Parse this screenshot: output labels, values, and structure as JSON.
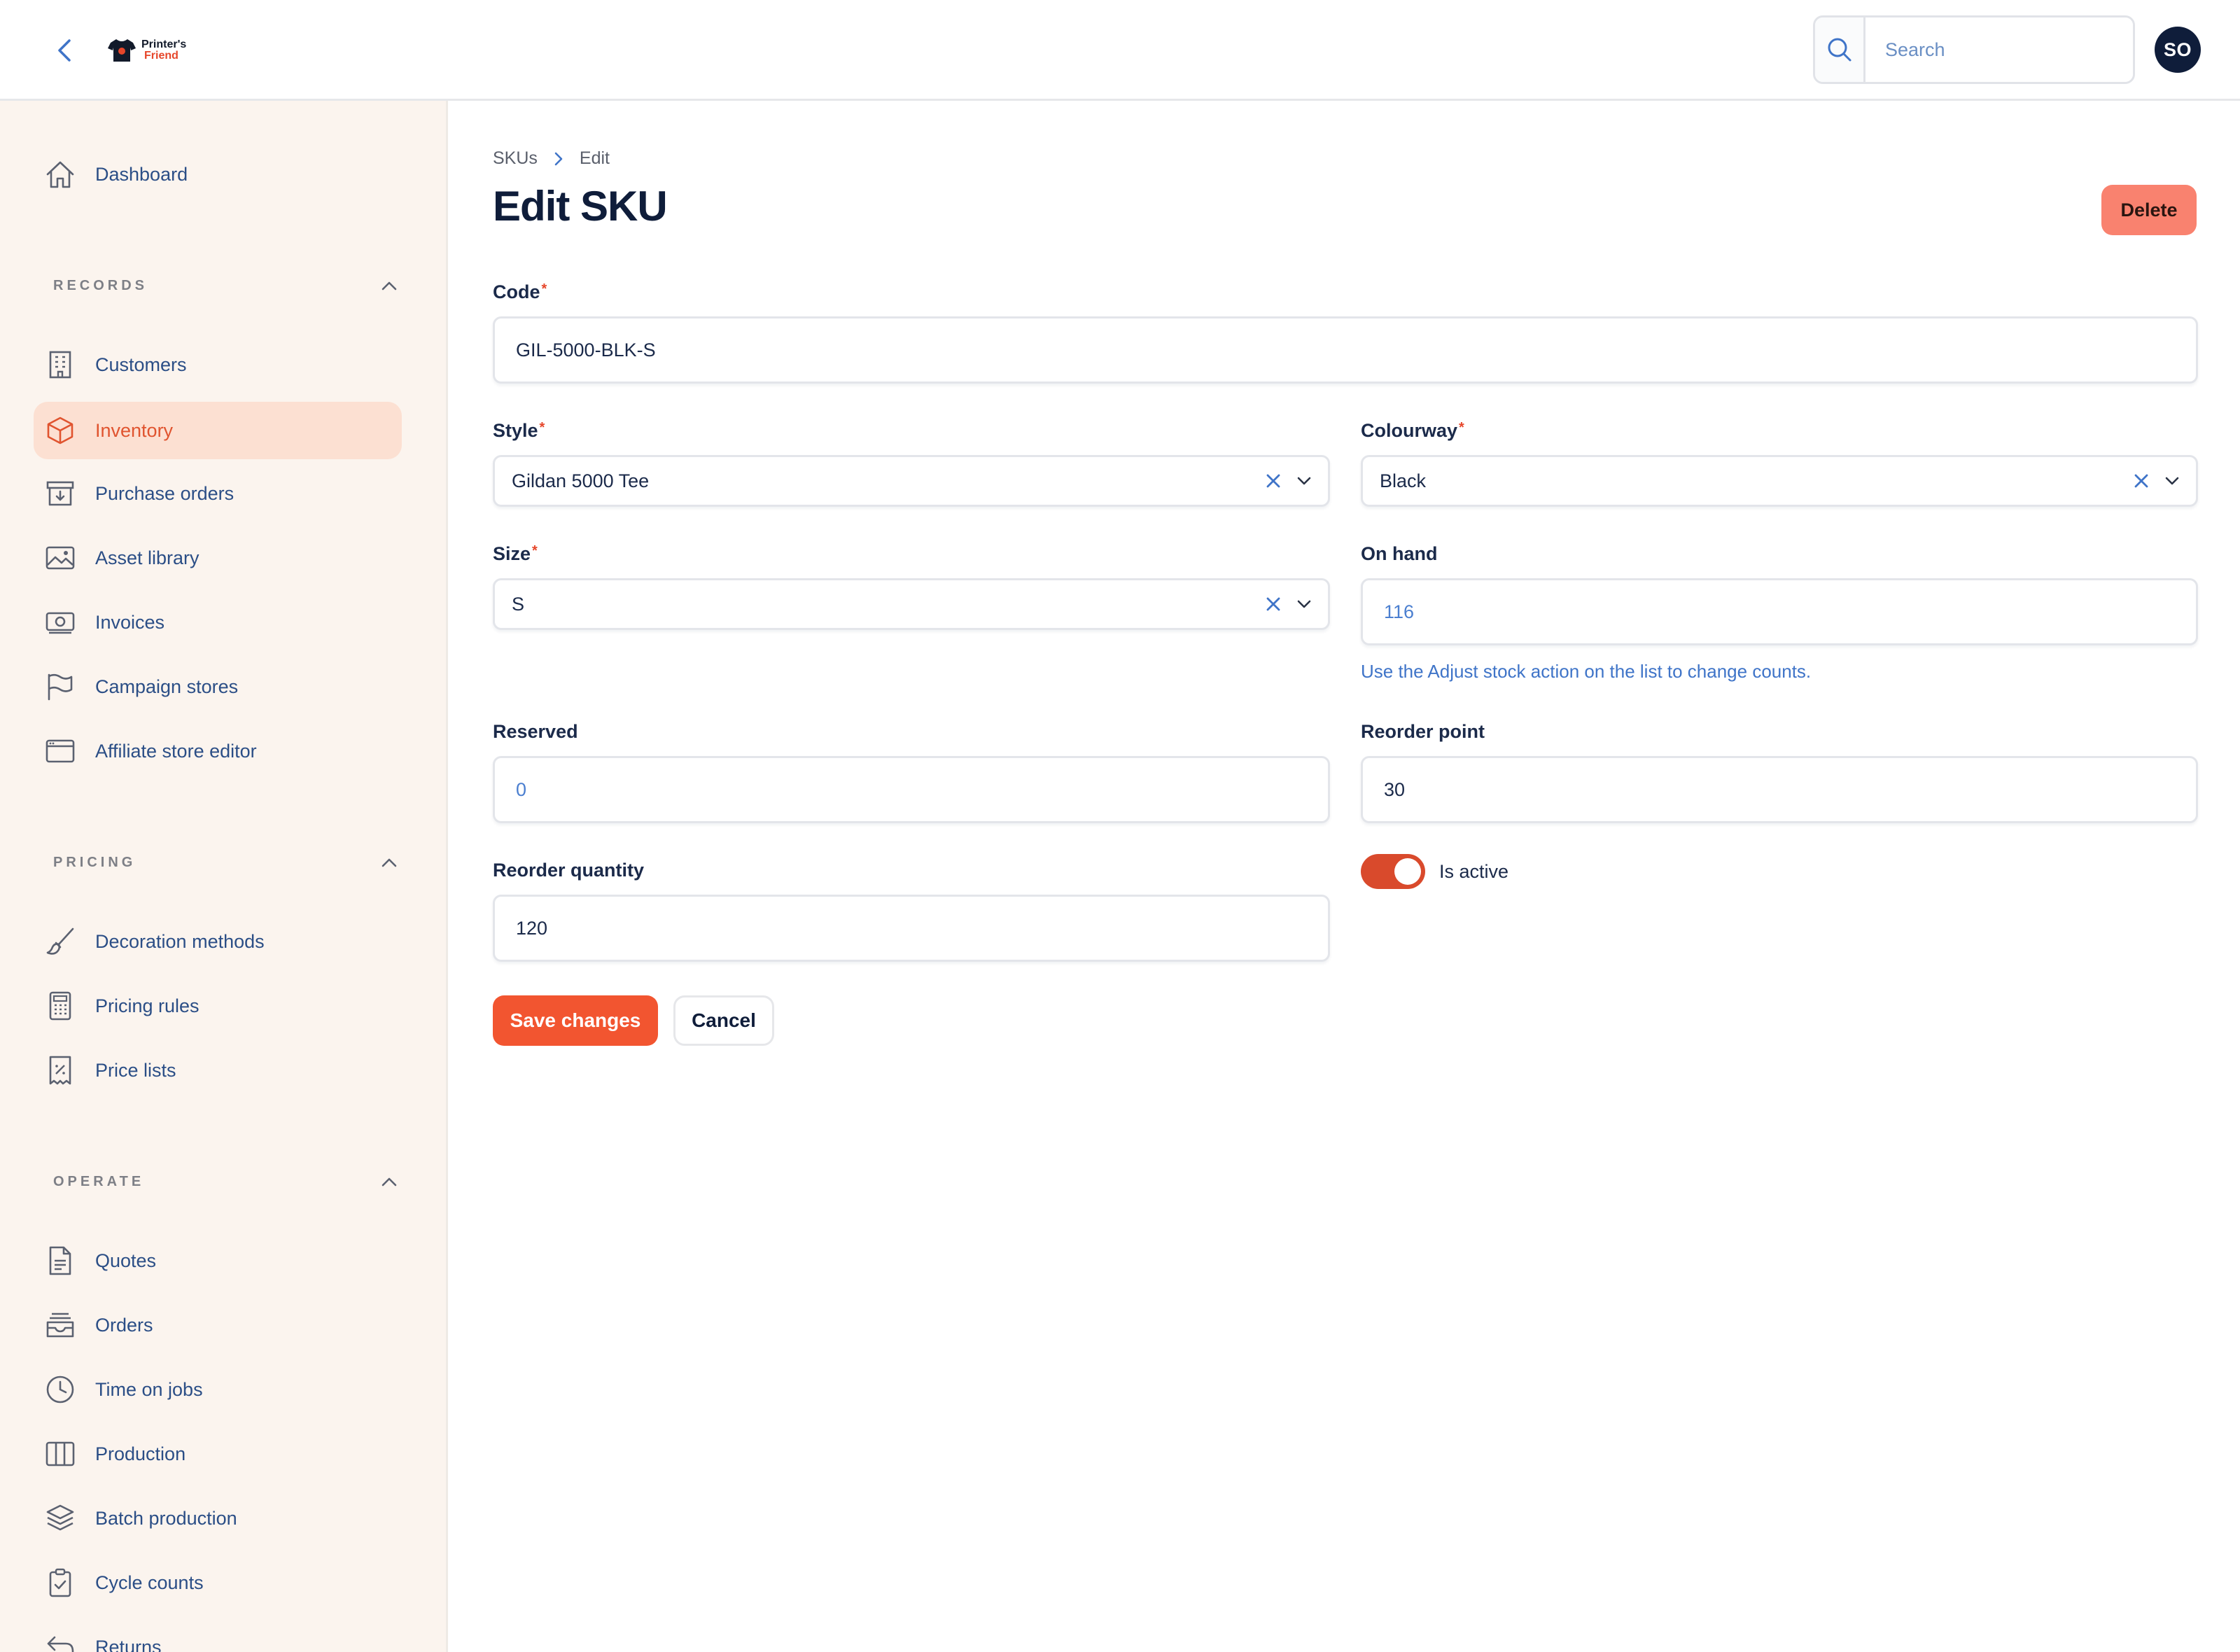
{
  "topbar": {
    "logo_line1": "Printer's",
    "logo_line2": "Friend",
    "search_placeholder": "Search",
    "avatar_initials": "SO"
  },
  "sidebar": {
    "dashboard": {
      "label": "Dashboard",
      "icon": "home-icon"
    },
    "sections": [
      {
        "title": "RECORDS",
        "items": [
          {
            "label": "Customers",
            "icon": "building-icon"
          },
          {
            "label": "Inventory",
            "icon": "cube-icon",
            "active": true
          },
          {
            "label": "Purchase orders",
            "icon": "archive-in-icon"
          },
          {
            "label": "Asset library",
            "icon": "image-icon"
          },
          {
            "label": "Invoices",
            "icon": "banknote-icon"
          },
          {
            "label": "Campaign stores",
            "icon": "flag-icon"
          },
          {
            "label": "Affiliate store editor",
            "icon": "browser-window-icon"
          }
        ]
      },
      {
        "title": "PRICING",
        "items": [
          {
            "label": "Decoration methods",
            "icon": "paintbrush-icon"
          },
          {
            "label": "Pricing rules",
            "icon": "calculator-icon"
          },
          {
            "label": "Price lists",
            "icon": "receipt-percent-icon"
          }
        ]
      },
      {
        "title": "OPERATE",
        "items": [
          {
            "label": "Quotes",
            "icon": "document-icon"
          },
          {
            "label": "Orders",
            "icon": "inbox-stack-icon"
          },
          {
            "label": "Time on jobs",
            "icon": "clock-icon"
          },
          {
            "label": "Production",
            "icon": "columns-icon"
          },
          {
            "label": "Batch production",
            "icon": "layers-icon"
          },
          {
            "label": "Cycle counts",
            "icon": "clipboard-check-icon"
          },
          {
            "label": "Returns",
            "icon": "return-arrow-icon"
          }
        ]
      }
    ]
  },
  "main": {
    "breadcrumb": {
      "parent": "SKUs",
      "current": "Edit"
    },
    "title": "Edit SKU",
    "delete_label": "Delete",
    "form": {
      "code": {
        "label": "Code",
        "value": "GIL-5000-BLK-S"
      },
      "style": {
        "label": "Style",
        "value": "Gildan 5000 Tee"
      },
      "colourway": {
        "label": "Colourway",
        "value": "Black"
      },
      "size": {
        "label": "Size",
        "value": "S"
      },
      "on_hand": {
        "label": "On hand",
        "value": "116",
        "helper": "Use the Adjust stock action on the list to change counts."
      },
      "reserved": {
        "label": "Reserved",
        "value": "0"
      },
      "reorder_point": {
        "label": "Reorder point",
        "value": "30"
      },
      "reorder_quantity": {
        "label": "Reorder quantity",
        "value": "120"
      },
      "is_active": {
        "label": "Is active",
        "value": true
      }
    },
    "save_label": "Save changes",
    "cancel_label": "Cancel"
  },
  "colors": {
    "accent": "#f25530",
    "active_nav_bg": "#fce0d2",
    "sidebar_bg": "#fbf4ee",
    "link_blue": "#2b4e86",
    "delete_bg": "#f9826f"
  }
}
